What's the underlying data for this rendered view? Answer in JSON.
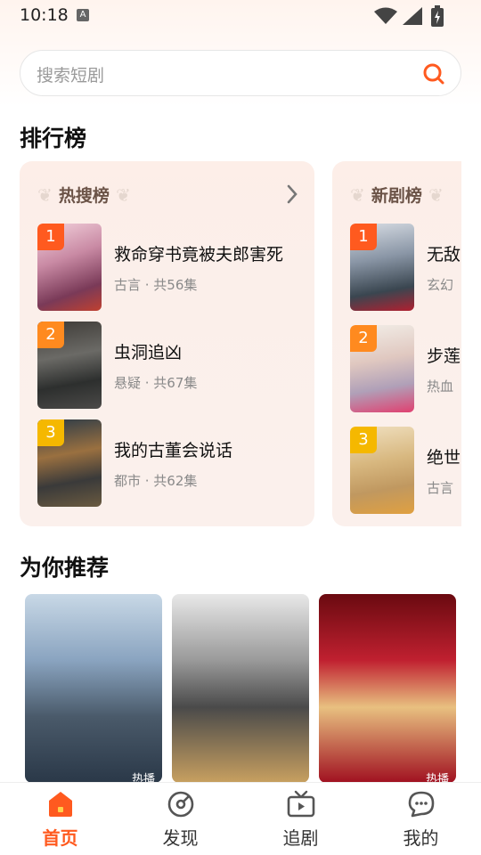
{
  "status_bar": {
    "time": "10:18",
    "notif_letter": "A"
  },
  "search": {
    "placeholder": "搜索短剧"
  },
  "ranking": {
    "title": "排行榜",
    "cards": [
      {
        "title": "热搜榜",
        "items": [
          {
            "rank": "1",
            "title": "救命穿书竟被夫郎害死",
            "meta": "古言 · 共56集",
            "badge_color": "#ff5a1f"
          },
          {
            "rank": "2",
            "title": "虫洞追凶",
            "meta": "悬疑 · 共67集",
            "badge_color": "#ff8a1f"
          },
          {
            "rank": "3",
            "title": "我的古董会说话",
            "meta": "都市 · 共62集",
            "badge_color": "#f5b800"
          }
        ]
      },
      {
        "title": "新剧榜",
        "items": [
          {
            "rank": "1",
            "title": "无敌",
            "meta": "玄幻",
            "badge_color": "#ff5a1f"
          },
          {
            "rank": "2",
            "title": "步莲",
            "meta": "热血",
            "badge_color": "#ff8a1f"
          },
          {
            "rank": "3",
            "title": "绝世",
            "meta": "古言",
            "badge_color": "#f5b800"
          }
        ]
      }
    ]
  },
  "recommend": {
    "title": "为你推荐",
    "cards": [
      {
        "tag": "热播"
      },
      {
        "tag": ""
      },
      {
        "tag": "热播"
      }
    ]
  },
  "nav": {
    "items": [
      {
        "label": "首页",
        "icon": "home-icon",
        "active": true
      },
      {
        "label": "发现",
        "icon": "discover-icon",
        "active": false
      },
      {
        "label": "追剧",
        "icon": "tv-icon",
        "active": false
      },
      {
        "label": "我的",
        "icon": "chat-icon",
        "active": false
      }
    ],
    "accent": "#ff5a1f"
  }
}
